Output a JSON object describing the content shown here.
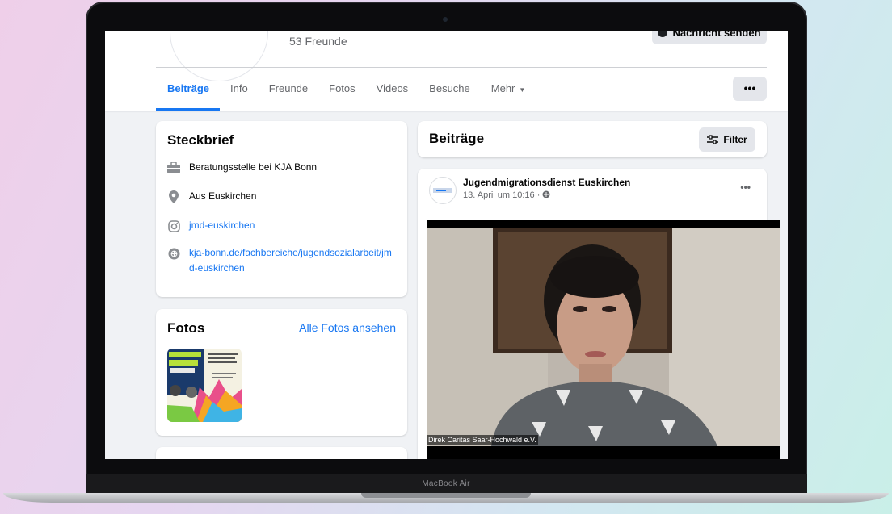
{
  "device": {
    "label": "MacBook Air"
  },
  "profile": {
    "friends_count": "53 Freunde",
    "message_button": "Nachricht senden"
  },
  "tabs": {
    "items": [
      {
        "label": "Beiträge",
        "active": true
      },
      {
        "label": "Info"
      },
      {
        "label": "Freunde"
      },
      {
        "label": "Fotos"
      },
      {
        "label": "Videos"
      },
      {
        "label": "Besuche"
      },
      {
        "label": "Mehr"
      }
    ],
    "more_icon": "caret-down-icon",
    "overflow_label": "•••"
  },
  "intro": {
    "title": "Steckbrief",
    "items": [
      {
        "icon": "briefcase-icon",
        "text": "Beratungsstelle bei KJA Bonn"
      },
      {
        "icon": "location-pin-icon",
        "text": "Aus Euskirchen"
      },
      {
        "icon": "instagram-icon",
        "text": "jmd-euskirchen",
        "is_link": true
      },
      {
        "icon": "globe-icon",
        "text": "kja-bonn.de/fachbereiche/jugendsozialarbeit/jmd-euskirchen",
        "is_link": true
      }
    ]
  },
  "photos": {
    "title": "Fotos",
    "see_all": "Alle Fotos ansehen"
  },
  "posts": {
    "title": "Beiträge",
    "filter_label": "Filter",
    "post": {
      "author": "Jugendmigrationsdienst Euskirchen",
      "date": "13. April um 10:16 ·",
      "privacy_icon": "globe-icon",
      "more": "•••"
    }
  },
  "video": {
    "caption": "Direk Caritas Saar-Hochwald e.V."
  },
  "colors": {
    "accent": "#1877f2",
    "page_bg": "#f0f2f5",
    "text_secondary": "#65676b"
  }
}
